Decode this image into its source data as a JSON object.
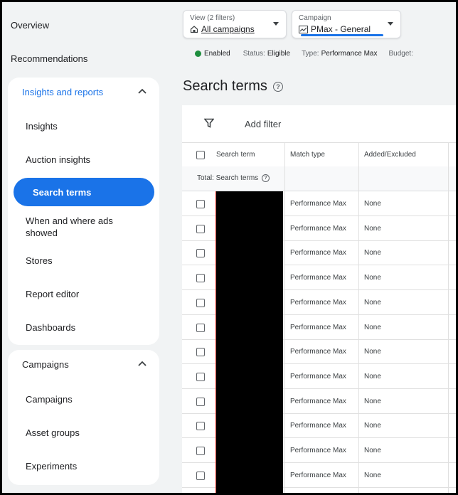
{
  "sidebar": {
    "overview": "Overview",
    "recommendations": "Recommendations",
    "insights_section": {
      "header": "Insights and reports",
      "items": [
        "Insights",
        "Auction insights",
        "Search terms",
        "When and where ads showed",
        "Stores",
        "Report editor",
        "Dashboards"
      ],
      "selected": "Search terms"
    },
    "campaigns_section": {
      "header": "Campaigns",
      "items": [
        "Campaigns",
        "Asset groups",
        "Experiments"
      ]
    }
  },
  "filters": {
    "view_caption": "View (2 filters)",
    "view_value": "All campaigns",
    "campaign_caption": "Campaign",
    "campaign_value": "PMax - General"
  },
  "status": {
    "enabled": "Enabled",
    "status_label": "Status:",
    "status_value": "Eligible",
    "type_label": "Type:",
    "type_value": "Performance Max",
    "budget_label": "Budget:"
  },
  "page": {
    "title": "Search terms",
    "add_filter": "Add filter"
  },
  "table": {
    "columns": [
      "Search term",
      "Match type",
      "Added/Excluded"
    ],
    "total_label": "Total: Search terms",
    "rows": [
      {
        "match_type": "Performance Max",
        "added": "None"
      },
      {
        "match_type": "Performance Max",
        "added": "None"
      },
      {
        "match_type": "Performance Max",
        "added": "None"
      },
      {
        "match_type": "Performance Max",
        "added": "None"
      },
      {
        "match_type": "Performance Max",
        "added": "None"
      },
      {
        "match_type": "Performance Max",
        "added": "None"
      },
      {
        "match_type": "Performance Max",
        "added": "None"
      },
      {
        "match_type": "Performance Max",
        "added": "None"
      },
      {
        "match_type": "Performance Max",
        "added": "None"
      },
      {
        "match_type": "Performance Max",
        "added": "None"
      },
      {
        "match_type": "Performance Max",
        "added": "None"
      },
      {
        "match_type": "Performance Max",
        "added": "None"
      }
    ]
  },
  "colors": {
    "accent": "#1a73e8",
    "enabled_green": "#1e8e3e",
    "redaction": "#000000"
  },
  "icons": [
    "chevron-up-icon",
    "dropdown-arrow-icon",
    "home-icon",
    "campaign-chart-icon",
    "help-circle-icon",
    "filter-funnel-icon",
    "checkbox-icon"
  ]
}
